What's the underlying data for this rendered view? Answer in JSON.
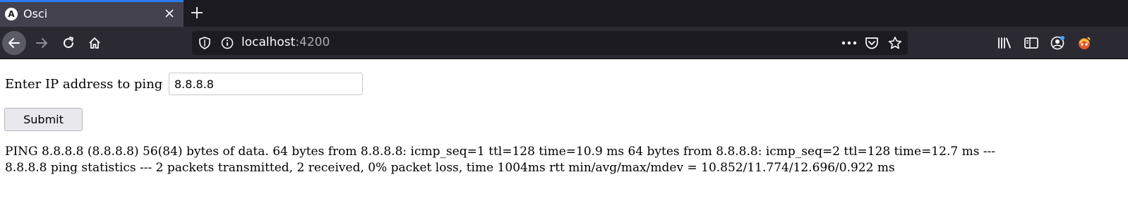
{
  "browser": {
    "tab": {
      "favicon_letter": "A",
      "title": "Osci"
    },
    "url": {
      "host": "localhost",
      "port": ":4200"
    },
    "colors": {
      "tabstrip": "#1c1b22",
      "active_tab": "#42414d",
      "tab_accent": "#2a7bf0",
      "toolbar": "#2b2a33",
      "urlbar": "#1c1b22"
    },
    "icons": {
      "close": "close-icon",
      "new_tab": "plus-icon",
      "back": "back-arrow-icon",
      "forward": "forward-arrow-icon",
      "reload": "reload-icon",
      "home": "home-icon",
      "tracking": "shield-icon",
      "site_info": "info-icon",
      "page_actions": "more-icon",
      "pocket": "pocket-icon",
      "bookmark": "star-icon",
      "library": "library-icon",
      "sidebar": "sidebar-icon",
      "account": "account-icon",
      "extension": "extension-icon"
    }
  },
  "page": {
    "ip_label": "Enter IP address to ping",
    "ip_value": "8.8.8.8",
    "submit_label": "Submit",
    "output_line_1": "PING 8.8.8.8 (8.8.8.8) 56(84) bytes of data. 64 bytes from 8.8.8.8: icmp_seq=1 ttl=128 time=10.9 ms 64 bytes from 8.8.8.8: icmp_seq=2 ttl=128 time=12.7 ms ---",
    "output_line_2": "8.8.8.8 ping statistics --- 2 packets transmitted, 2 received, 0% packet loss, time 1004ms rtt min/avg/max/mdev = 10.852/11.774/12.696/0.922 ms"
  }
}
